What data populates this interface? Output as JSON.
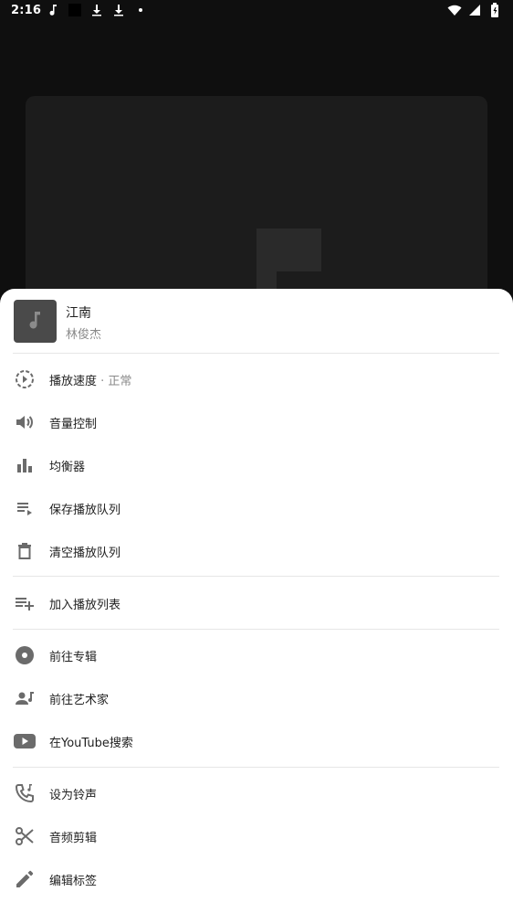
{
  "status": {
    "time": "2:16",
    "left_icons": [
      "music-note-icon",
      "black-square-icon",
      "download-icon",
      "download-icon",
      "dot-icon"
    ],
    "right_icons": [
      "wifi-icon",
      "signal-icon",
      "battery-icon"
    ]
  },
  "song": {
    "title": "江南",
    "artist": "林俊杰"
  },
  "menu": {
    "playback_speed": {
      "label": "播放速度",
      "suffix": " · 正常",
      "icon": "playback-speed-icon"
    },
    "volume": {
      "label": "音量控制",
      "icon": "volume-icon"
    },
    "equalizer": {
      "label": "均衡器",
      "icon": "equalizer-icon"
    },
    "save_queue": {
      "label": "保存播放队列",
      "icon": "playlist-play-icon"
    },
    "clear_queue": {
      "label": "清空播放队列",
      "icon": "trash-icon"
    },
    "add_to_playlist": {
      "label": "加入播放列表",
      "icon": "playlist-add-icon"
    },
    "go_album": {
      "label": "前往专辑",
      "icon": "album-icon"
    },
    "go_artist": {
      "label": "前往艺术家",
      "icon": "artist-icon"
    },
    "youtube_search": {
      "label": "在YouTube搜索",
      "icon": "youtube-icon"
    },
    "set_ringtone": {
      "label": "设为铃声",
      "icon": "phone-ringtone-icon"
    },
    "audio_cut": {
      "label": "音频剪辑",
      "icon": "scissors-icon"
    },
    "edit_tags": {
      "label": "编辑标签",
      "icon": "pencil-icon"
    }
  },
  "colors": {
    "sheet_bg": "#ffffff",
    "icon": "#6b6b6b",
    "text": "#1f1f1f",
    "subtext": "#8a8a8a",
    "youtube_red_icon": "#6b6b6b"
  }
}
